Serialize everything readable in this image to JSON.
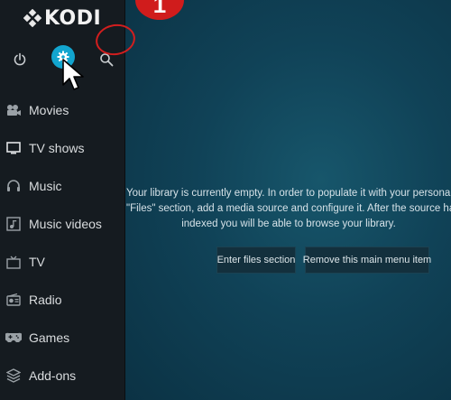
{
  "logo": {
    "text": "KODI",
    "icon": "kodi-logo-icon"
  },
  "top_icons": [
    {
      "name": "power-icon"
    },
    {
      "name": "settings-icon",
      "highlight": "#12a5cf"
    },
    {
      "name": "search-icon"
    }
  ],
  "annotation": {
    "badge": "1",
    "color": "#d01c1c"
  },
  "menu": [
    {
      "label": "Movies",
      "icon": "movies-icon"
    },
    {
      "label": "TV shows",
      "icon": "tv-shows-icon"
    },
    {
      "label": "Music",
      "icon": "music-icon"
    },
    {
      "label": "Music videos",
      "icon": "music-videos-icon"
    },
    {
      "label": "TV",
      "icon": "tv-icon"
    },
    {
      "label": "Radio",
      "icon": "radio-icon"
    },
    {
      "label": "Games",
      "icon": "games-icon"
    },
    {
      "label": "Add-ons",
      "icon": "add-ons-icon"
    }
  ],
  "library": {
    "lines": [
      "Your library is currently empty. In order to populate it with your personal m",
      "\"Files\" section, add a media source and configure it. After the source has bee",
      "indexed you will be able to browse your library."
    ],
    "enter_files_label": "Enter files section",
    "remove_label": "Remove this main menu item"
  },
  "colors": {
    "sidebar": "#151b20",
    "background": "#104257",
    "accent": "#12a5cf"
  }
}
